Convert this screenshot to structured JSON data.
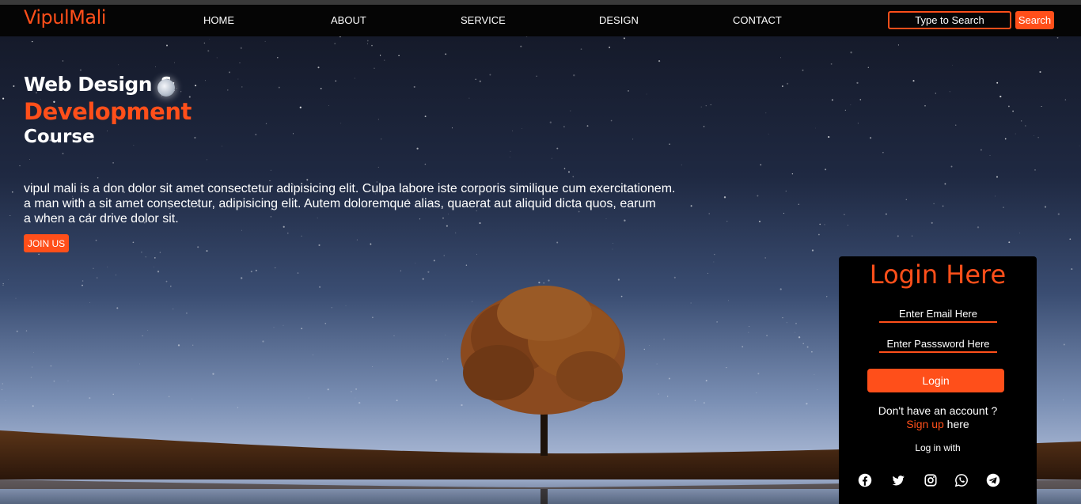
{
  "brand": {
    "logo": "VipulMali",
    "accent_color": "#ff4f1a"
  },
  "nav": {
    "items": [
      {
        "label": "HOME"
      },
      {
        "label": "ABOUT"
      },
      {
        "label": "SERVICE"
      },
      {
        "label": "DESIGN"
      },
      {
        "label": "CONTACT"
      }
    ]
  },
  "search": {
    "placeholder": "Type to Search",
    "button_label": "Search"
  },
  "hero": {
    "title_line1": "Web Design &",
    "title_line2": "Development",
    "title_line3": "Course",
    "decor_icon": "moon-icon",
    "description_lines": [
      "vipul mali is a don dolor sit amet consectetur adipisicing elit. Culpa labore iste corporis similique cum exercitationem.",
      "a man with a sit amet consectetur, adipisicing elit. Autem doloremque alias, quaerat aut aliquid dicta quos, earum",
      "a when a car drive dolor sit."
    ],
    "join_label": "JOIN US"
  },
  "login": {
    "title": "Login Here",
    "email_placeholder": "Enter Email Here",
    "password_placeholder": "Enter Passsword Here",
    "button_label": "Login",
    "no_account_text": "Don't have an account ?",
    "signup_link": "Sign up",
    "signup_suffix": " here",
    "login_with_text": "Log in with",
    "social_icons": [
      "facebook-icon",
      "twitter-icon",
      "instagram-icon",
      "whatsapp-icon",
      "telegram-icon"
    ]
  }
}
